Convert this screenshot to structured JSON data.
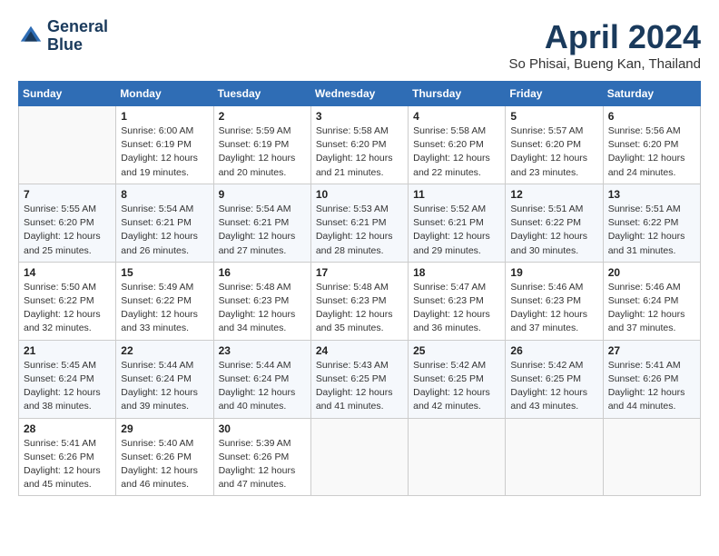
{
  "header": {
    "logo_line1": "General",
    "logo_line2": "Blue",
    "month": "April 2024",
    "location": "So Phisai, Bueng Kan, Thailand"
  },
  "weekdays": [
    "Sunday",
    "Monday",
    "Tuesday",
    "Wednesday",
    "Thursday",
    "Friday",
    "Saturday"
  ],
  "weeks": [
    [
      {
        "day": "",
        "info": ""
      },
      {
        "day": "1",
        "info": "Sunrise: 6:00 AM\nSunset: 6:19 PM\nDaylight: 12 hours\nand 19 minutes."
      },
      {
        "day": "2",
        "info": "Sunrise: 5:59 AM\nSunset: 6:19 PM\nDaylight: 12 hours\nand 20 minutes."
      },
      {
        "day": "3",
        "info": "Sunrise: 5:58 AM\nSunset: 6:20 PM\nDaylight: 12 hours\nand 21 minutes."
      },
      {
        "day": "4",
        "info": "Sunrise: 5:58 AM\nSunset: 6:20 PM\nDaylight: 12 hours\nand 22 minutes."
      },
      {
        "day": "5",
        "info": "Sunrise: 5:57 AM\nSunset: 6:20 PM\nDaylight: 12 hours\nand 23 minutes."
      },
      {
        "day": "6",
        "info": "Sunrise: 5:56 AM\nSunset: 6:20 PM\nDaylight: 12 hours\nand 24 minutes."
      }
    ],
    [
      {
        "day": "7",
        "info": "Sunrise: 5:55 AM\nSunset: 6:20 PM\nDaylight: 12 hours\nand 25 minutes."
      },
      {
        "day": "8",
        "info": "Sunrise: 5:54 AM\nSunset: 6:21 PM\nDaylight: 12 hours\nand 26 minutes."
      },
      {
        "day": "9",
        "info": "Sunrise: 5:54 AM\nSunset: 6:21 PM\nDaylight: 12 hours\nand 27 minutes."
      },
      {
        "day": "10",
        "info": "Sunrise: 5:53 AM\nSunset: 6:21 PM\nDaylight: 12 hours\nand 28 minutes."
      },
      {
        "day": "11",
        "info": "Sunrise: 5:52 AM\nSunset: 6:21 PM\nDaylight: 12 hours\nand 29 minutes."
      },
      {
        "day": "12",
        "info": "Sunrise: 5:51 AM\nSunset: 6:22 PM\nDaylight: 12 hours\nand 30 minutes."
      },
      {
        "day": "13",
        "info": "Sunrise: 5:51 AM\nSunset: 6:22 PM\nDaylight: 12 hours\nand 31 minutes."
      }
    ],
    [
      {
        "day": "14",
        "info": "Sunrise: 5:50 AM\nSunset: 6:22 PM\nDaylight: 12 hours\nand 32 minutes."
      },
      {
        "day": "15",
        "info": "Sunrise: 5:49 AM\nSunset: 6:22 PM\nDaylight: 12 hours\nand 33 minutes."
      },
      {
        "day": "16",
        "info": "Sunrise: 5:48 AM\nSunset: 6:23 PM\nDaylight: 12 hours\nand 34 minutes."
      },
      {
        "day": "17",
        "info": "Sunrise: 5:48 AM\nSunset: 6:23 PM\nDaylight: 12 hours\nand 35 minutes."
      },
      {
        "day": "18",
        "info": "Sunrise: 5:47 AM\nSunset: 6:23 PM\nDaylight: 12 hours\nand 36 minutes."
      },
      {
        "day": "19",
        "info": "Sunrise: 5:46 AM\nSunset: 6:23 PM\nDaylight: 12 hours\nand 37 minutes."
      },
      {
        "day": "20",
        "info": "Sunrise: 5:46 AM\nSunset: 6:24 PM\nDaylight: 12 hours\nand 37 minutes."
      }
    ],
    [
      {
        "day": "21",
        "info": "Sunrise: 5:45 AM\nSunset: 6:24 PM\nDaylight: 12 hours\nand 38 minutes."
      },
      {
        "day": "22",
        "info": "Sunrise: 5:44 AM\nSunset: 6:24 PM\nDaylight: 12 hours\nand 39 minutes."
      },
      {
        "day": "23",
        "info": "Sunrise: 5:44 AM\nSunset: 6:24 PM\nDaylight: 12 hours\nand 40 minutes."
      },
      {
        "day": "24",
        "info": "Sunrise: 5:43 AM\nSunset: 6:25 PM\nDaylight: 12 hours\nand 41 minutes."
      },
      {
        "day": "25",
        "info": "Sunrise: 5:42 AM\nSunset: 6:25 PM\nDaylight: 12 hours\nand 42 minutes."
      },
      {
        "day": "26",
        "info": "Sunrise: 5:42 AM\nSunset: 6:25 PM\nDaylight: 12 hours\nand 43 minutes."
      },
      {
        "day": "27",
        "info": "Sunrise: 5:41 AM\nSunset: 6:26 PM\nDaylight: 12 hours\nand 44 minutes."
      }
    ],
    [
      {
        "day": "28",
        "info": "Sunrise: 5:41 AM\nSunset: 6:26 PM\nDaylight: 12 hours\nand 45 minutes."
      },
      {
        "day": "29",
        "info": "Sunrise: 5:40 AM\nSunset: 6:26 PM\nDaylight: 12 hours\nand 46 minutes."
      },
      {
        "day": "30",
        "info": "Sunrise: 5:39 AM\nSunset: 6:26 PM\nDaylight: 12 hours\nand 47 minutes."
      },
      {
        "day": "",
        "info": ""
      },
      {
        "day": "",
        "info": ""
      },
      {
        "day": "",
        "info": ""
      },
      {
        "day": "",
        "info": ""
      }
    ]
  ]
}
